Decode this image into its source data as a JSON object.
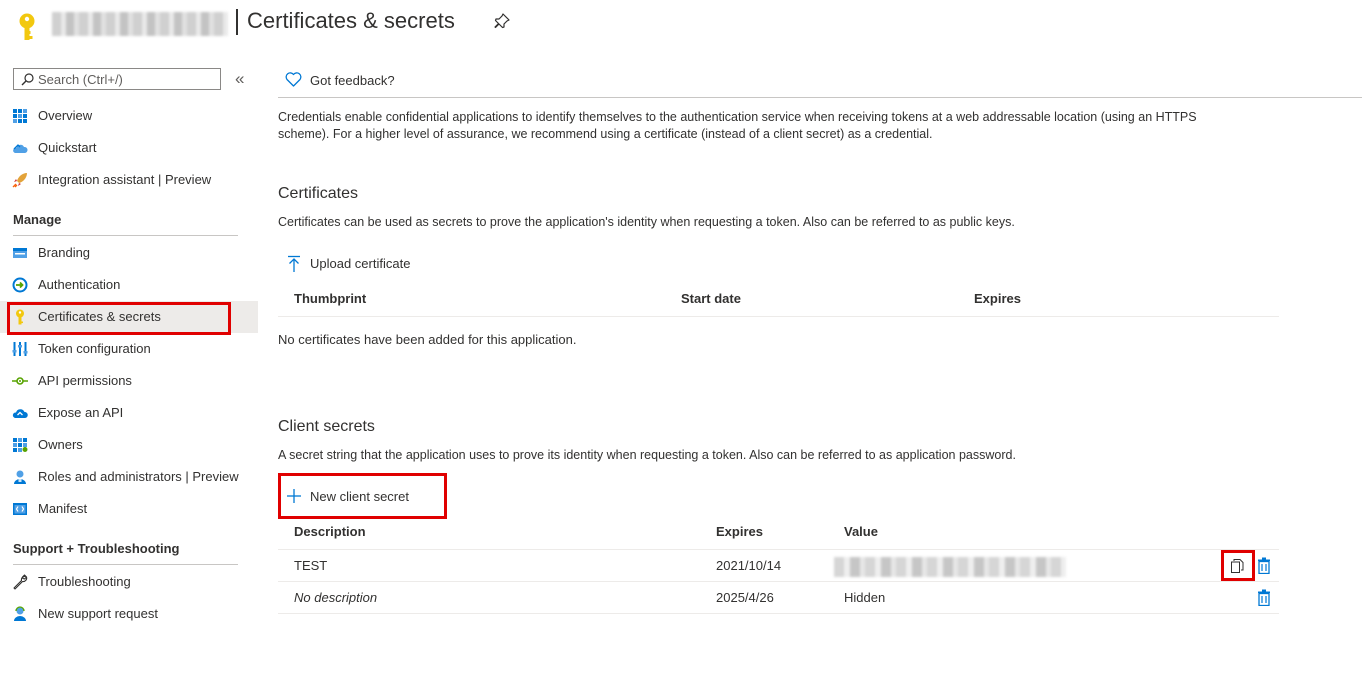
{
  "header": {
    "title": "Certificates & secrets"
  },
  "sidebar": {
    "search_placeholder": "Search (Ctrl+/)",
    "collapse_label": "«",
    "top_items": [
      {
        "label": "Overview",
        "icon": "overview-grid-icon"
      },
      {
        "label": "Quickstart",
        "icon": "cloud-icon"
      },
      {
        "label": "Integration assistant | Preview",
        "icon": "rocket-icon"
      }
    ],
    "manage_header": "Manage",
    "manage_items": [
      {
        "label": "Branding",
        "icon": "branding-icon"
      },
      {
        "label": "Authentication",
        "icon": "authentication-icon"
      },
      {
        "label": "Certificates & secrets",
        "icon": "key-icon",
        "selected": true
      },
      {
        "label": "Token configuration",
        "icon": "token-config-icon"
      },
      {
        "label": "API permissions",
        "icon": "api-permissions-icon"
      },
      {
        "label": "Expose an API",
        "icon": "expose-api-cloud-icon"
      },
      {
        "label": "Owners",
        "icon": "owners-grid-icon"
      },
      {
        "label": "Roles and administrators | Preview",
        "icon": "roles-user-icon"
      },
      {
        "label": "Manifest",
        "icon": "manifest-icon"
      }
    ],
    "support_header": "Support + Troubleshooting",
    "support_items": [
      {
        "label": "Troubleshooting",
        "icon": "wrench-icon"
      },
      {
        "label": "New support request",
        "icon": "support-person-icon"
      }
    ]
  },
  "main": {
    "feedback_label": "Got feedback?",
    "intro": "Credentials enable confidential applications to identify themselves to the authentication service when receiving tokens at a web addressable location (using an HTTPS scheme). For a higher level of assurance, we recommend using a certificate (instead of a client secret) as a credential.",
    "certificates": {
      "heading": "Certificates",
      "description": "Certificates can be used as secrets to prove the application's identity when requesting a token. Also can be referred to as public keys.",
      "upload_label": "Upload certificate",
      "columns": [
        "Thumbprint",
        "Start date",
        "Expires"
      ],
      "empty_message": "No certificates have been added for this application."
    },
    "client_secrets": {
      "heading": "Client secrets",
      "description": "A secret string that the application uses to prove its identity when requesting a token. Also can be referred to as application password.",
      "new_label": "New client secret",
      "columns": [
        "Description",
        "Expires",
        "Value"
      ],
      "rows": [
        {
          "description": "TEST",
          "expires": "2021/10/14",
          "value": ""
        },
        {
          "description": "No description",
          "expires": "2025/4/26",
          "value": "Hidden"
        }
      ]
    }
  },
  "colors": {
    "accent": "#0078d4",
    "highlight_box": "#e00000",
    "key_gold": "#f2c80f",
    "selected_bg": "#edebe9"
  }
}
